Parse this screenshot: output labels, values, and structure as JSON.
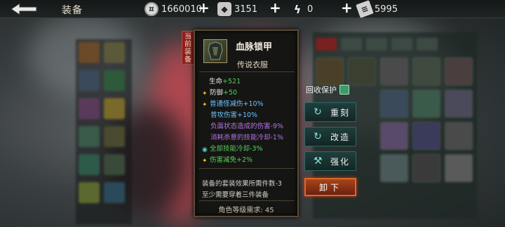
{
  "header": {
    "title": "装备",
    "resources": [
      {
        "icon": "coin-icon",
        "value": "1660010"
      },
      {
        "icon": "ingot-icon",
        "value": "3151"
      },
      {
        "icon": "lightning-icon",
        "value": "0"
      },
      {
        "icon": "ticket-icon",
        "value": "5995"
      }
    ]
  },
  "equip_tag": "当前装备",
  "item": {
    "name": "血脉锁甲",
    "type": "传说衣服",
    "stats": [
      {
        "label": "生命",
        "value": "+521",
        "style": "base",
        "icon": ""
      },
      {
        "label": "防御",
        "value": "+50",
        "style": "base",
        "icon": "star-icon"
      },
      {
        "text": "普通怪减伤+10%",
        "style": "blue",
        "icon": "star-icon"
      },
      {
        "text": "普攻伤害+10%",
        "style": "blue",
        "icon": ""
      },
      {
        "text": "负面状态造成的伤害-9%",
        "style": "purple",
        "icon": ""
      },
      {
        "text": "消耗杀意的技能冷却-1%",
        "style": "purple",
        "icon": ""
      },
      {
        "text": "全部技能冷却-3%",
        "style": "green",
        "icon": "swirl-icon"
      },
      {
        "text": "伤害减免+2%",
        "style": "green",
        "icon": "star-icon"
      }
    ],
    "set_notes": [
      "装备的套装效果所需件数-3",
      "至少需要穿着三件装备"
    ],
    "level_requirement": "角色等级需求: 45"
  },
  "actions": {
    "recycle_protect": "回收保护",
    "reforge": "重刻",
    "remake": "改造",
    "enhance": "强化",
    "unequip": "卸下"
  },
  "colors": {
    "accent_teal": "#2b6a66",
    "unequip_orange": "#d86a2a",
    "stat_green": "#57d05a",
    "stat_purple": "#b673e8",
    "stat_blue": "#6cc1ff"
  }
}
